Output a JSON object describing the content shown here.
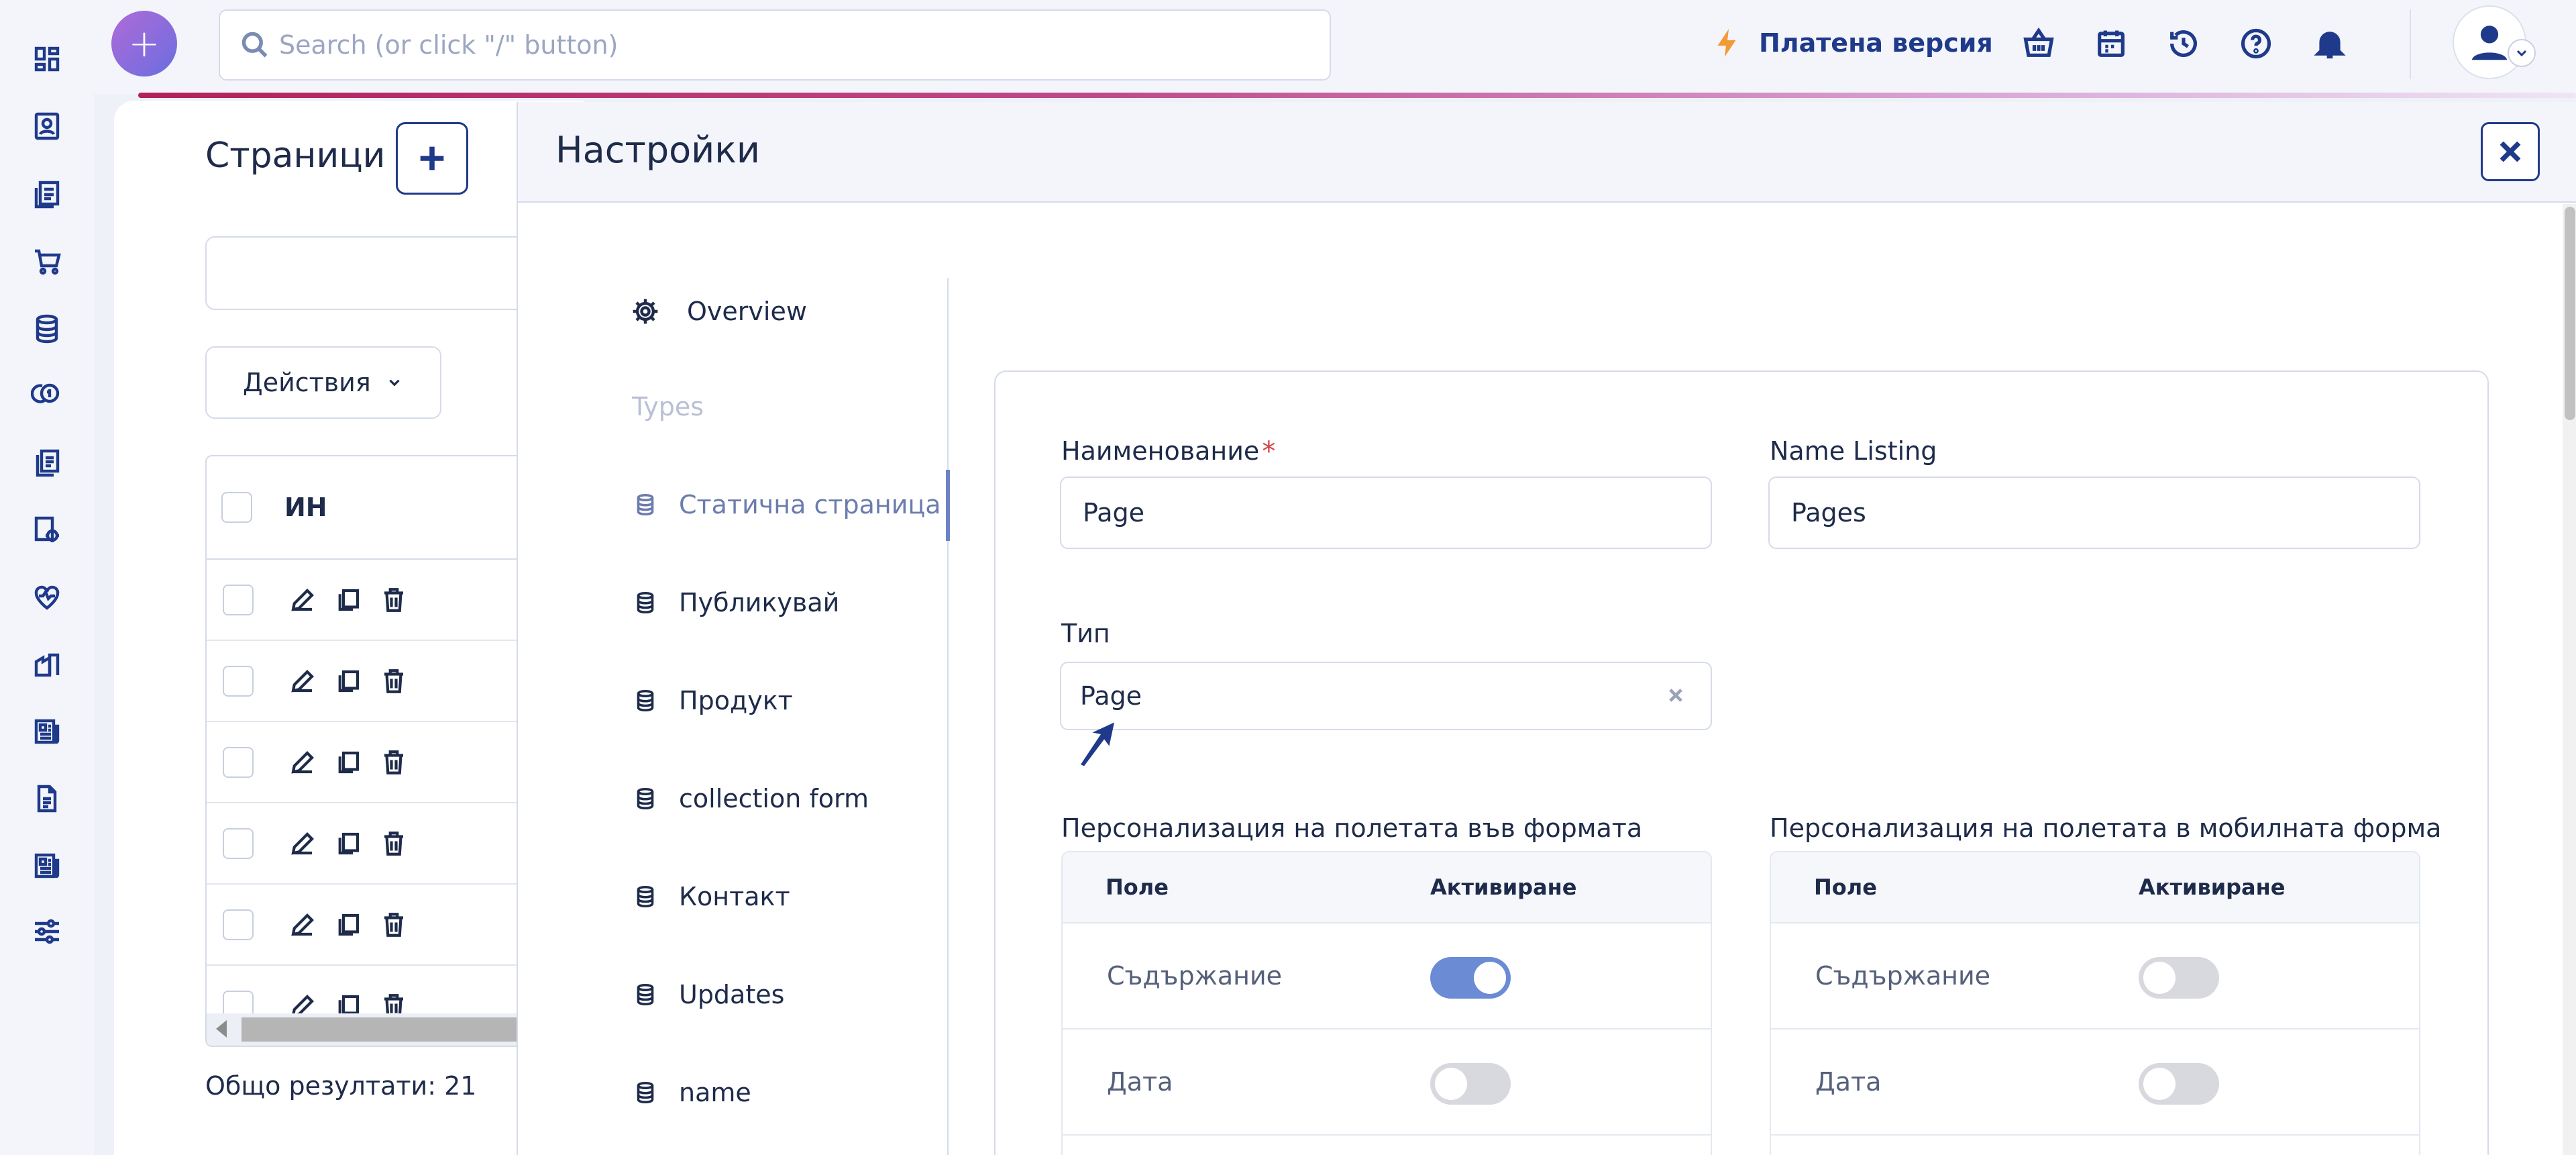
{
  "search": {
    "placeholder": "Search (or click \"/\" button)"
  },
  "topbar": {
    "paid_label": "Платена версия"
  },
  "pages": {
    "title": "Страници",
    "actions_label": "Действия",
    "table_header": "ИН",
    "row_count": 6,
    "total_label": "Общо резултати: 21"
  },
  "settings": {
    "title": "Настройки",
    "nav": {
      "overview": "Overview",
      "types_group": "Types",
      "items": [
        "Статична страница",
        "Публикувай",
        "Продукт",
        "collection form",
        "Контакт",
        "Updates",
        "name"
      ],
      "active_index": 0
    },
    "form": {
      "name_label": "Наименование",
      "name_value": "Page",
      "name_listing_label": "Name Listing",
      "name_listing_value": "Pages",
      "type_label": "Тип",
      "type_value": "Page",
      "desktop_fields_label": "Персонализация на полетата във формата",
      "mobile_fields_label": "Персонализация на полетата в мобилната форма",
      "col_field": "Поле",
      "col_enable": "Активиране",
      "desktop_rows": [
        {
          "field": "Съдържание",
          "enabled": true
        },
        {
          "field": "Дата",
          "enabled": false
        }
      ],
      "mobile_rows": [
        {
          "field": "Съдържание",
          "enabled": false
        },
        {
          "field": "Дата",
          "enabled": false
        }
      ]
    }
  },
  "colors": {
    "accent": "#1f3a8a",
    "toggle_on": "#6b8bd4",
    "required": "#d93d4a",
    "paid_bolt": "#f29a36"
  }
}
